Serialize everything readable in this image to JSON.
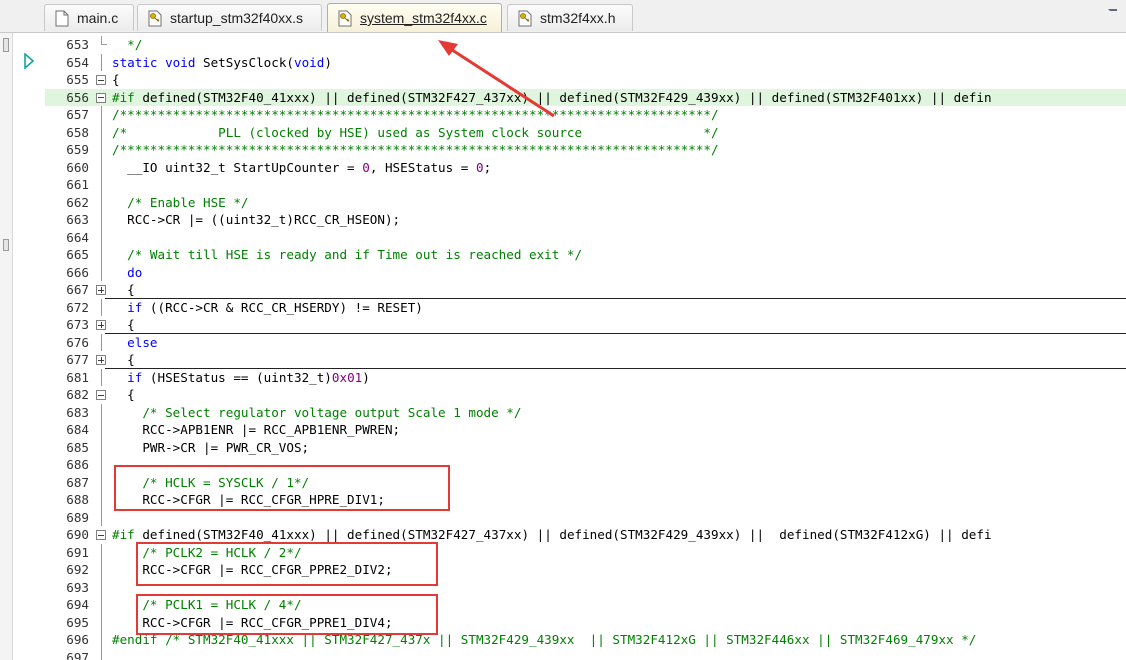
{
  "tabs": [
    {
      "label": "main.c",
      "active": false
    },
    {
      "label": "startup_stm32f40xx.s",
      "active": false
    },
    {
      "label": "system_stm32f4xx.c",
      "active": true
    },
    {
      "label": "stm32f4xx.h",
      "active": false
    }
  ],
  "code_lines": [
    {
      "n": "653",
      "fold": "end",
      "segments": [
        {
          "t": "  */",
          "c": "cm"
        }
      ]
    },
    {
      "n": "654",
      "fold": "",
      "segments": [
        {
          "t": "static void ",
          "c": "kw"
        },
        {
          "t": "SetSysClock(",
          "c": ""
        },
        {
          "t": "void",
          "c": "kw"
        },
        {
          "t": ")",
          "c": ""
        }
      ]
    },
    {
      "n": "655",
      "fold": "minus",
      "segments": [
        {
          "t": "{",
          "c": ""
        }
      ]
    },
    {
      "n": "656",
      "fold": "minus",
      "hl": true,
      "segments": [
        {
          "t": "#if ",
          "c": "pp"
        },
        {
          "t": "defined(STM32F40_41xxx) || defined(STM32F427_437xx) || defined(STM32F429_439xx) || defined(STM32F401xx) || defin",
          "c": ""
        }
      ]
    },
    {
      "n": "657",
      "fold": "",
      "segments": [
        {
          "t": "/******************************************************************************/",
          "c": "cm"
        }
      ]
    },
    {
      "n": "658",
      "fold": "",
      "segments": [
        {
          "t": "/*            PLL (clocked by HSE) used as System clock source                */",
          "c": "cm"
        }
      ]
    },
    {
      "n": "659",
      "fold": "",
      "segments": [
        {
          "t": "/******************************************************************************/",
          "c": "cm"
        }
      ]
    },
    {
      "n": "660",
      "fold": "",
      "segments": [
        {
          "t": "  __IO uint32_t StartUpCounter = ",
          "c": ""
        },
        {
          "t": "0",
          "c": "num"
        },
        {
          "t": ", HSEStatus = ",
          "c": ""
        },
        {
          "t": "0",
          "c": "num"
        },
        {
          "t": ";",
          "c": ""
        }
      ]
    },
    {
      "n": "661",
      "fold": "",
      "segments": []
    },
    {
      "n": "662",
      "fold": "",
      "segments": [
        {
          "t": "  /* Enable HSE */",
          "c": "cm"
        }
      ]
    },
    {
      "n": "663",
      "fold": "",
      "segments": [
        {
          "t": "  RCC->CR |= ((uint32_t)RCC_CR_HSEON);",
          "c": ""
        }
      ]
    },
    {
      "n": "664",
      "fold": "",
      "segments": []
    },
    {
      "n": "665",
      "fold": "",
      "segments": [
        {
          "t": "  /* Wait till HSE is ready and if Time out is reached exit */",
          "c": "cm"
        }
      ]
    },
    {
      "n": "666",
      "fold": "",
      "segments": [
        {
          "t": "  do",
          "c": "kw"
        }
      ]
    },
    {
      "n": "667",
      "fold": "plus",
      "sep": true,
      "segments": [
        {
          "t": "  {",
          "c": ""
        }
      ]
    },
    {
      "n": "672",
      "fold": "",
      "segments": [
        {
          "t": "  if ",
          "c": "kw"
        },
        {
          "t": "((RCC->CR & RCC_CR_HSERDY) != RESET)",
          "c": ""
        }
      ]
    },
    {
      "n": "673",
      "fold": "plus",
      "sep": true,
      "segments": [
        {
          "t": "  {",
          "c": ""
        }
      ]
    },
    {
      "n": "676",
      "fold": "",
      "segments": [
        {
          "t": "  else",
          "c": "kw"
        }
      ]
    },
    {
      "n": "677",
      "fold": "plus",
      "sep": true,
      "segments": [
        {
          "t": "  {",
          "c": ""
        }
      ]
    },
    {
      "n": "681",
      "fold": "",
      "segments": [
        {
          "t": "  if ",
          "c": "kw"
        },
        {
          "t": "(HSEStatus == (uint32_t)",
          "c": ""
        },
        {
          "t": "0x01",
          "c": "num"
        },
        {
          "t": ")",
          "c": ""
        }
      ]
    },
    {
      "n": "682",
      "fold": "minus",
      "segments": [
        {
          "t": "  {",
          "c": ""
        }
      ]
    },
    {
      "n": "683",
      "fold": "",
      "segments": [
        {
          "t": "    /* Select regulator voltage output Scale 1 mode */",
          "c": "cm"
        }
      ]
    },
    {
      "n": "684",
      "fold": "",
      "segments": [
        {
          "t": "    RCC->APB1ENR |= RCC_APB1ENR_PWREN;",
          "c": ""
        }
      ]
    },
    {
      "n": "685",
      "fold": "",
      "segments": [
        {
          "t": "    PWR->CR |= PWR_CR_VOS;",
          "c": ""
        }
      ]
    },
    {
      "n": "686",
      "fold": "",
      "segments": []
    },
    {
      "n": "687",
      "fold": "",
      "segments": [
        {
          "t": "    /* HCLK = SYSCLK / 1*/",
          "c": "cm"
        }
      ]
    },
    {
      "n": "688",
      "fold": "",
      "segments": [
        {
          "t": "    RCC->CFGR |= RCC_CFGR_HPRE_DIV1;",
          "c": ""
        }
      ]
    },
    {
      "n": "689",
      "fold": "",
      "segments": []
    },
    {
      "n": "690",
      "fold": "minus",
      "segments": [
        {
          "t": "#if ",
          "c": "pp"
        },
        {
          "t": "defined(STM32F40_41xxx) || defined(STM32F427_437xx) || defined(STM32F429_439xx) ||  defined(STM32F412xG) || defi",
          "c": ""
        }
      ]
    },
    {
      "n": "691",
      "fold": "",
      "segments": [
        {
          "t": "    /* PCLK2 = HCLK / 2*/",
          "c": "cm"
        }
      ]
    },
    {
      "n": "692",
      "fold": "",
      "segments": [
        {
          "t": "    RCC->CFGR |= RCC_CFGR_PPRE2_DIV2;",
          "c": ""
        }
      ]
    },
    {
      "n": "693",
      "fold": "",
      "segments": []
    },
    {
      "n": "694",
      "fold": "",
      "segments": [
        {
          "t": "    /* PCLK1 = HCLK / 4*/",
          "c": "cm"
        }
      ]
    },
    {
      "n": "695",
      "fold": "",
      "segments": [
        {
          "t": "    RCC->CFGR |= RCC_CFGR_PPRE1_DIV4;",
          "c": ""
        }
      ]
    },
    {
      "n": "696",
      "fold": "",
      "segments": [
        {
          "t": "#endif /* STM32F40_41xxx || STM32F427_437x || STM32F429_439xx  || STM32F412xG || STM32F446xx || STM32F469_479xx */",
          "c": "cm"
        }
      ]
    },
    {
      "n": "697",
      "fold": "",
      "segments": []
    }
  ],
  "colors": {
    "keyword": "#0000ff",
    "comment": "#008000",
    "number": "#800080",
    "annotation": "#e53935",
    "highlight_line": "#dff5dd"
  }
}
